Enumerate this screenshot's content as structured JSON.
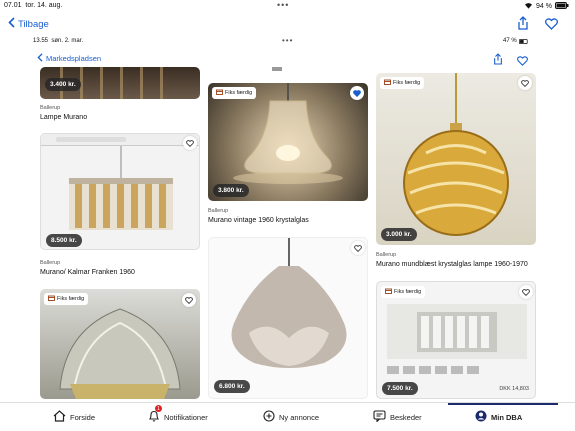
{
  "outer_status": {
    "time": "07.01",
    "date": "tor. 14. aug.",
    "battery": "94 %"
  },
  "outer_nav": {
    "back_label": "Tilbage"
  },
  "inner_status": {
    "time": "13.55",
    "date": "søn. 2. mar.",
    "battery": "47 %"
  },
  "inner_nav": {
    "back_label": "Markedspladsen"
  },
  "colors": {
    "accent": "#1a5fd0",
    "price_bg": "#333333"
  },
  "listings": [
    {
      "price": "3.400 kr.",
      "location": "Ballerup",
      "title": "Lampe Murano"
    },
    {
      "price": "8.500 kr.",
      "location": "Ballerup",
      "title": "Murano/ Kalmar Franken 1960"
    },
    {
      "price": "",
      "location": "",
      "title": "",
      "fiks": "Fiks færdig"
    },
    {
      "price": "3.800 kr.",
      "location": "Ballerup",
      "title": "Murano vintage 1960 krystalglas",
      "fiks": "Fiks færdig"
    },
    {
      "price": "6.800 kr.",
      "location": "",
      "title": ""
    },
    {
      "price": "3.000 kr.",
      "location": "Ballerup",
      "title": "Murano mundblæst krystalglas lampe 1960-1970",
      "fiks": "Fiks færdig"
    },
    {
      "price": "7.500 kr.",
      "location": "",
      "title": "",
      "fiks": "Fiks færdig",
      "extra": "DKK 14,803"
    }
  ],
  "tabs": [
    {
      "label": "Forside",
      "icon": "home-icon"
    },
    {
      "label": "Notifikationer",
      "icon": "bell-icon",
      "badge": "1"
    },
    {
      "label": "Ny annonce",
      "icon": "plus-circle-icon"
    },
    {
      "label": "Beskeder",
      "icon": "message-icon"
    },
    {
      "label": "Min DBA",
      "icon": "profile-icon"
    }
  ]
}
